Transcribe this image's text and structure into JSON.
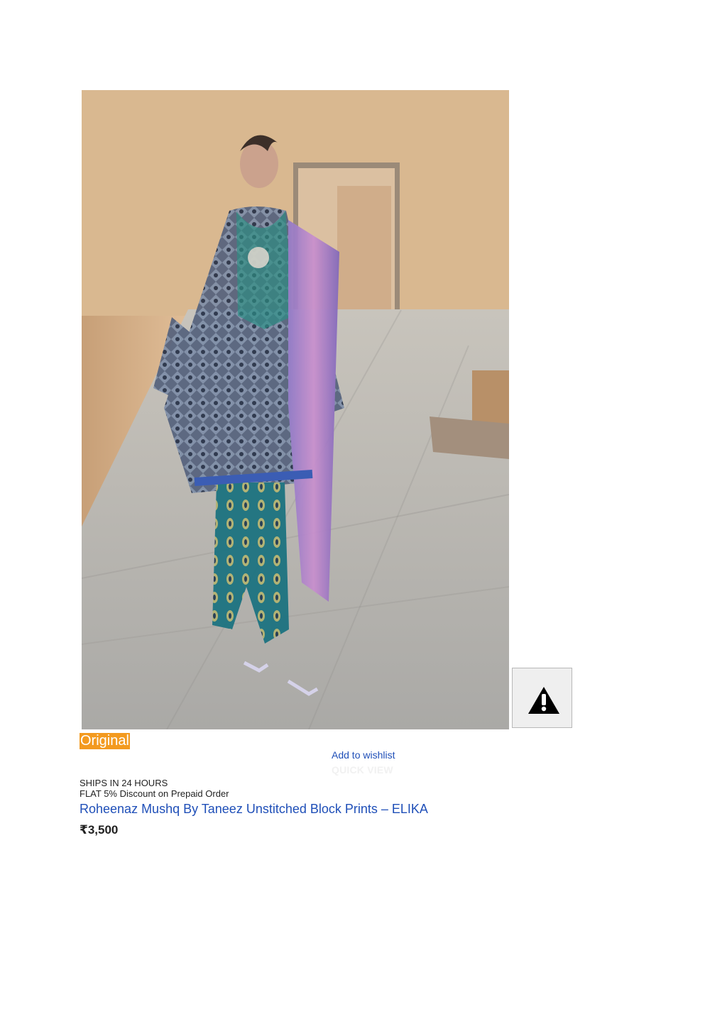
{
  "product": {
    "badge": "Original",
    "wishlist_label": "Add to wishlist",
    "quick_view_label": "QUICK VIEW",
    "shipping_note": "SHIPS IN 24 HOURS",
    "discount_note": "FLAT 5% Discount on Prepaid Order",
    "title": "Roheenaz Mushq By Taneez Unstitched Block Prints – ELIKA",
    "price": "₹3,500",
    "image_subject": "model in blue printed unstitched suit",
    "broken_image_icon": "warning-icon"
  },
  "colors": {
    "badge_background": "#f39a1f",
    "link": "#1f4fb8",
    "price_text": "#222222",
    "broken_image_background": "#efefef"
  }
}
